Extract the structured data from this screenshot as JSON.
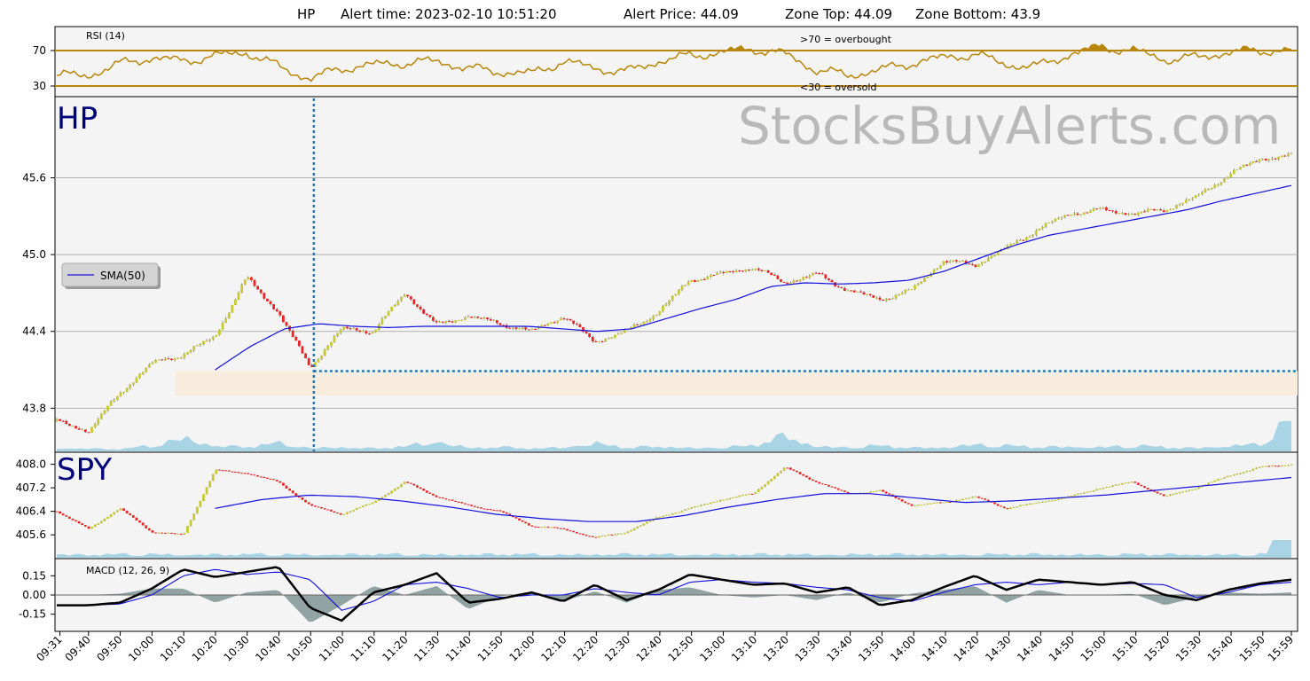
{
  "header": {
    "symbol": "HP",
    "alert_time": "Alert time: 2023-02-10 10:51:20",
    "alert_price": "Alert Price: 44.09",
    "zone_top": "Zone Top: 44.09",
    "zone_bottom": "Zone Bottom: 43.9"
  },
  "watermark": "StocksBuyAlerts.com",
  "colors": {
    "up": "#c8c832",
    "down": "#ee2222",
    "sma": "#1010dd",
    "rsi": "#b8860b",
    "volume": "#a8d4e6",
    "macd_hist": "#7f9494",
    "signal": "#1010dd",
    "alert": "#1f77b4",
    "zone": "#f8ecdc",
    "panel_bg": "#f4f4f4",
    "symbol_text": "#00007a"
  },
  "chart_data": [
    {
      "type": "line",
      "panel": "rsi",
      "label": "RSI (14)",
      "yticks": [
        "70",
        "30"
      ],
      "ylim": [
        20,
        95
      ],
      "overbought": 70,
      "oversold": 30,
      "overbought_label": ">70 = overbought",
      "oversold_label": "<30 = oversold",
      "x": [
        "09:31",
        "09:40",
        "09:50",
        "10:00",
        "10:10",
        "10:20",
        "10:30",
        "10:40",
        "10:50",
        "11:00",
        "11:10",
        "11:20",
        "11:30",
        "11:40",
        "11:50",
        "12:00",
        "12:10",
        "12:20",
        "12:30",
        "12:40",
        "12:50",
        "13:00",
        "13:10",
        "13:20",
        "13:30",
        "13:40",
        "13:50",
        "14:00",
        "14:10",
        "14:20",
        "14:30",
        "14:40",
        "14:50",
        "15:00",
        "15:10",
        "15:20",
        "15:30",
        "15:40",
        "15:50",
        "15:59"
      ],
      "values": [
        42,
        42,
        55,
        62,
        58,
        64,
        68,
        52,
        38,
        50,
        54,
        56,
        58,
        50,
        46,
        44,
        58,
        50,
        46,
        58,
        64,
        68,
        72,
        66,
        48,
        42,
        48,
        56,
        62,
        66,
        54,
        52,
        66,
        74,
        70,
        60,
        62,
        68,
        70,
        70
      ]
    },
    {
      "type": "candlestick",
      "panel": "price",
      "symbol": "HP",
      "yticks": [
        "45.6",
        "45.0",
        "44.4",
        "43.8"
      ],
      "ylim": [
        43.47,
        46.22
      ],
      "x": [
        "09:31",
        "09:40",
        "09:50",
        "10:00",
        "10:10",
        "10:20",
        "10:30",
        "10:40",
        "10:50",
        "11:00",
        "11:10",
        "11:20",
        "11:30",
        "11:40",
        "11:50",
        "12:00",
        "12:10",
        "12:20",
        "12:30",
        "12:40",
        "12:50",
        "13:00",
        "13:10",
        "13:20",
        "13:30",
        "13:40",
        "13:50",
        "14:00",
        "14:10",
        "14:20",
        "14:30",
        "14:40",
        "14:50",
        "15:00",
        "15:10",
        "15:20",
        "15:30",
        "15:40",
        "15:50",
        "15:59"
      ],
      "close": [
        43.7,
        43.62,
        43.92,
        44.15,
        44.22,
        44.36,
        44.82,
        44.55,
        44.12,
        44.42,
        44.4,
        44.7,
        44.45,
        44.52,
        44.46,
        44.4,
        44.52,
        44.32,
        44.4,
        44.55,
        44.8,
        44.85,
        44.9,
        44.78,
        44.85,
        44.72,
        44.65,
        44.72,
        44.95,
        44.92,
        45.05,
        45.2,
        45.32,
        45.35,
        45.32,
        45.35,
        45.45,
        45.62,
        45.75,
        45.77
      ],
      "sma_legend": "SMA(50)",
      "sma_start_index": 5,
      "sma50": [
        44.1,
        44.28,
        44.42,
        44.46,
        44.44,
        44.43,
        44.44,
        44.44,
        44.44,
        44.44,
        44.42,
        44.4,
        44.42,
        44.5,
        44.58,
        44.65,
        44.75,
        44.78,
        44.77,
        44.78,
        44.8,
        44.87,
        44.97,
        45.07,
        45.15,
        45.2,
        45.25,
        45.3,
        45.35,
        45.42,
        45.48,
        45.54
      ],
      "alert_time": "10:51",
      "alert_price": 44.09,
      "zone_top": 44.09,
      "zone_bottom": 43.9,
      "volume": [
        0.05,
        0.04,
        0.03,
        0.08,
        0.2,
        0.08,
        0.06,
        0.12,
        0.05,
        0.06,
        0.04,
        0.07,
        0.15,
        0.05,
        0.06,
        0.04,
        0.06,
        0.12,
        0.05,
        0.07,
        0.05,
        0.06,
        0.08,
        0.22,
        0.07,
        0.06,
        0.08,
        0.05,
        0.06,
        0.1,
        0.08,
        0.06,
        0.07,
        0.06,
        0.08,
        0.06,
        0.05,
        0.08,
        0.1,
        0.45
      ]
    },
    {
      "type": "candlestick",
      "panel": "spy",
      "symbol": "SPY",
      "yticks": [
        "408.0",
        "407.2",
        "406.4",
        "405.6"
      ],
      "ylim": [
        404.85,
        408.35
      ],
      "x": [
        "09:31",
        "09:40",
        "09:50",
        "10:00",
        "10:10",
        "10:20",
        "10:30",
        "10:40",
        "10:50",
        "11:00",
        "11:10",
        "11:20",
        "11:30",
        "11:40",
        "11:50",
        "12:00",
        "12:10",
        "12:20",
        "12:30",
        "12:40",
        "12:50",
        "13:00",
        "13:10",
        "13:20",
        "13:30",
        "13:40",
        "13:50",
        "14:00",
        "14:10",
        "14:20",
        "14:30",
        "14:40",
        "14:50",
        "15:00",
        "15:10",
        "15:20",
        "15:30",
        "15:40",
        "15:50",
        "15:59"
      ],
      "close": [
        406.4,
        405.8,
        406.5,
        405.7,
        405.6,
        407.8,
        407.7,
        407.4,
        406.6,
        406.3,
        406.7,
        407.4,
        406.9,
        406.6,
        406.4,
        405.9,
        405.8,
        405.5,
        405.7,
        406.2,
        406.5,
        406.8,
        407.0,
        407.9,
        407.4,
        407.0,
        407.1,
        406.6,
        406.7,
        406.9,
        406.5,
        406.7,
        406.9,
        407.2,
        407.4,
        406.9,
        407.2,
        407.6,
        407.9,
        408.0
      ],
      "sma_start_index": 5,
      "sma50": [
        406.5,
        406.8,
        406.95,
        406.9,
        406.75,
        406.55,
        406.3,
        406.15,
        406.05,
        406.05,
        406.25,
        406.55,
        406.8,
        407.0,
        407.0,
        406.85,
        406.7,
        406.75,
        406.85,
        406.95,
        407.1,
        407.25,
        407.4,
        407.55
      ]
    },
    {
      "type": "line",
      "panel": "macd",
      "label": "MACD (12, 26, 9)",
      "yticks": [
        "0.15",
        "0.00",
        "-0.15"
      ],
      "ylim": [
        -0.27,
        0.27
      ],
      "x": [
        "09:31",
        "09:40",
        "09:50",
        "10:00",
        "10:10",
        "10:20",
        "10:30",
        "10:40",
        "10:50",
        "11:00",
        "11:10",
        "11:20",
        "11:30",
        "11:40",
        "11:50",
        "12:00",
        "12:10",
        "12:20",
        "12:30",
        "12:40",
        "12:50",
        "13:00",
        "13:10",
        "13:20",
        "13:30",
        "13:40",
        "13:50",
        "14:00",
        "14:10",
        "14:20",
        "14:30",
        "14:40",
        "14:50",
        "15:00",
        "15:10",
        "15:20",
        "15:30",
        "15:40",
        "15:50",
        "15:59"
      ],
      "macd": [
        -0.08,
        -0.08,
        -0.06,
        0.05,
        0.2,
        0.14,
        0.18,
        0.22,
        -0.1,
        -0.2,
        0.02,
        0.08,
        0.17,
        -0.06,
        -0.03,
        0.02,
        -0.05,
        0.08,
        -0.04,
        0.04,
        0.16,
        0.12,
        0.08,
        0.09,
        0.02,
        0.06,
        -0.08,
        -0.04,
        0.06,
        0.15,
        0.04,
        0.12,
        0.1,
        0.08,
        0.1,
        0.0,
        -0.04,
        0.04,
        0.09,
        0.12
      ],
      "signal": [
        -0.08,
        -0.08,
        -0.07,
        0.0,
        0.15,
        0.2,
        0.16,
        0.18,
        0.12,
        -0.12,
        -0.05,
        0.08,
        0.1,
        0.05,
        -0.02,
        0.0,
        0.0,
        0.05,
        0.02,
        0.0,
        0.1,
        0.12,
        0.1,
        0.09,
        0.06,
        0.04,
        -0.02,
        -0.05,
        0.02,
        0.08,
        0.1,
        0.08,
        0.1,
        0.08,
        0.09,
        0.08,
        -0.02,
        0.02,
        0.08,
        0.1
      ],
      "histogram": [
        0.0,
        0.0,
        0.01,
        0.05,
        0.05,
        -0.06,
        0.02,
        0.04,
        -0.22,
        -0.08,
        0.07,
        0.0,
        0.07,
        -0.11,
        -0.01,
        0.02,
        -0.05,
        0.03,
        -0.06,
        0.04,
        0.06,
        0.0,
        -0.02,
        0.0,
        -0.04,
        0.02,
        -0.06,
        0.01,
        0.04,
        0.07,
        -0.06,
        0.04,
        0.0,
        0.0,
        0.01,
        -0.08,
        -0.02,
        0.02,
        0.01,
        0.02
      ]
    }
  ]
}
